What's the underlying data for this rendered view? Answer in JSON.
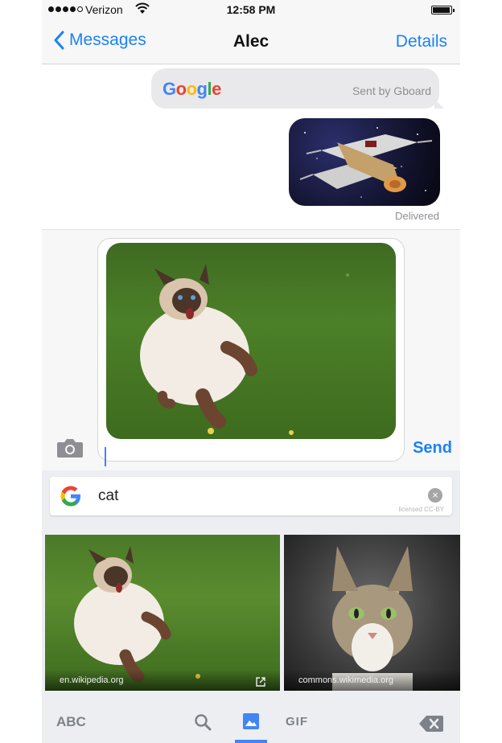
{
  "status_bar": {
    "carrier": "Verizon",
    "time": "12:58 PM"
  },
  "nav": {
    "back_label": "Messages",
    "title": "Alec",
    "details_label": "Details"
  },
  "conversation": {
    "google_card": {
      "logo_text": "Google",
      "sent_by": "Sent by Gboard"
    },
    "delivered": "Delivered"
  },
  "compose": {
    "send_label": "Send"
  },
  "keyboard": {
    "search_query": "cat",
    "license_note": "licensed CC-BY",
    "results": [
      {
        "source": "en.wikipedia.org"
      },
      {
        "source": "commons.wikimedia.org"
      }
    ],
    "tabs": {
      "abc": "ABC",
      "gif": "GIF"
    },
    "active_tab": "images"
  },
  "colors": {
    "accent": "#1a82f7",
    "google_blue": "#4285f4",
    "google_red": "#ea4335",
    "google_yellow": "#fbbc05",
    "google_green": "#34a853"
  }
}
